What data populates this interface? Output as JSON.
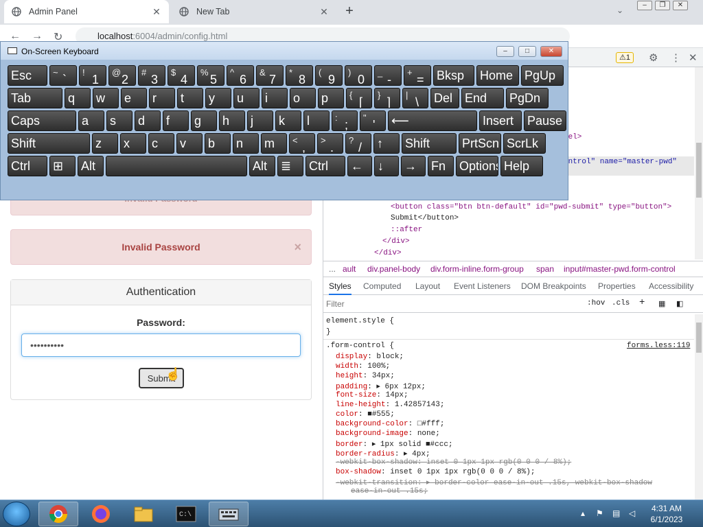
{
  "browser": {
    "tabs": [
      {
        "title": "Admin Panel",
        "active": true
      },
      {
        "title": "New Tab",
        "active": false
      }
    ],
    "new_tab_label": "+",
    "url_host": "localhost",
    "url_rest": ":6004/admin/config.html"
  },
  "page": {
    "alert_partial": "Invalid Password",
    "alert_text": "Invalid Password",
    "alert_close": "×",
    "panel_title": "Authentication",
    "password_label": "Password:",
    "password_value": "••••••••••",
    "submit_label": "Submit"
  },
  "osk": {
    "title": "On-Screen Keyboard",
    "rows": [
      [
        [
          "Esc",
          ""
        ],
        [
          "`",
          "~"
        ],
        [
          "1",
          "!"
        ],
        [
          "2",
          "@"
        ],
        [
          "3",
          "#"
        ],
        [
          "4",
          "$"
        ],
        [
          "5",
          "%"
        ],
        [
          "6",
          "^"
        ],
        [
          "7",
          "&"
        ],
        [
          "8",
          "*"
        ],
        [
          "9",
          "("
        ],
        [
          "0",
          ")"
        ],
        [
          "-",
          "_"
        ],
        [
          "=",
          "+"
        ],
        [
          "Bksp",
          ""
        ],
        [
          "Home",
          ""
        ],
        [
          "PgUp",
          ""
        ]
      ],
      [
        [
          "Tab",
          ""
        ],
        [
          "q",
          ""
        ],
        [
          "w",
          ""
        ],
        [
          "e",
          ""
        ],
        [
          "r",
          ""
        ],
        [
          "t",
          ""
        ],
        [
          "y",
          ""
        ],
        [
          "u",
          ""
        ],
        [
          "i",
          ""
        ],
        [
          "o",
          ""
        ],
        [
          "p",
          ""
        ],
        [
          "[",
          "{"
        ],
        [
          "]",
          "}"
        ],
        [
          "\\",
          "|"
        ],
        [
          "Del",
          ""
        ],
        [
          "End",
          ""
        ],
        [
          "PgDn",
          ""
        ]
      ],
      [
        [
          "Caps",
          ""
        ],
        [
          "a",
          ""
        ],
        [
          "s",
          ""
        ],
        [
          "d",
          ""
        ],
        [
          "f",
          ""
        ],
        [
          "g",
          ""
        ],
        [
          "h",
          ""
        ],
        [
          "j",
          ""
        ],
        [
          "k",
          ""
        ],
        [
          "l",
          ""
        ],
        [
          ";",
          ":"
        ],
        [
          "'",
          "\""
        ],
        [
          "⟵",
          ""
        ],
        [
          "Insert",
          ""
        ],
        [
          "Pause",
          ""
        ]
      ],
      [
        [
          "Shift",
          ""
        ],
        [
          "z",
          ""
        ],
        [
          "x",
          ""
        ],
        [
          "c",
          ""
        ],
        [
          "v",
          ""
        ],
        [
          "b",
          ""
        ],
        [
          "n",
          ""
        ],
        [
          "m",
          ""
        ],
        [
          ",",
          "<"
        ],
        [
          ".",
          ">"
        ],
        [
          "/",
          "?"
        ],
        [
          "↑",
          ""
        ],
        [
          "Shift",
          ""
        ],
        [
          "PrtScn",
          ""
        ],
        [
          "ScrLk",
          ""
        ]
      ],
      [
        [
          "Ctrl",
          ""
        ],
        [
          "⊞",
          ""
        ],
        [
          "Alt",
          ""
        ],
        [
          "",
          ""
        ],
        [
          "Alt",
          ""
        ],
        [
          "≣",
          ""
        ],
        [
          "Ctrl",
          ""
        ],
        [
          "←",
          ""
        ],
        [
          "↓",
          ""
        ],
        [
          "→",
          ""
        ],
        [
          "Fn",
          ""
        ],
        [
          "Options",
          ""
        ],
        [
          "Help",
          ""
        ]
      ]
    ]
  },
  "devtools": {
    "warning_count": "1",
    "code_lines": [
      {
        "t": "bel>"
      },
      {
        "t": "ontrol\" name=\"master-pwd\""
      },
      {
        "t": "<button class=\"btn btn-default\" id=\"pwd-submit\" type=\"button\">"
      },
      {
        "t": "Submit</button>"
      },
      {
        "t": "::after"
      },
      {
        "t": "</div>"
      },
      {
        "t": "</div>"
      }
    ],
    "breadcrumbs": [
      "...",
      "ault",
      "div.panel-body",
      "div.form-inline.form-group",
      "span",
      "input#master-pwd.form-control"
    ],
    "subtabs": [
      "Styles",
      "Computed",
      "Layout",
      "Event Listeners",
      "DOM Breakpoints",
      "Properties",
      "Accessibility"
    ],
    "filter_placeholder": "Filter",
    "filter_hov": ":hov",
    "filter_cls": ".cls",
    "filter_plus": "+",
    "element_style": "element.style {",
    "element_close": "}",
    "rule_selector": ".form-control {",
    "rule_source": "forms.less:119",
    "props": [
      {
        "p": "display",
        "v": "block;"
      },
      {
        "p": "width",
        "v": "100%;"
      },
      {
        "p": "height",
        "v": "34px;"
      },
      {
        "p": "padding",
        "v": "▸ 6px 12px;"
      },
      {
        "p": "font-size",
        "v": "14px;"
      },
      {
        "p": "line-height",
        "v": "1.42857143;"
      },
      {
        "p": "color",
        "v": "■#555;"
      },
      {
        "p": "background-color",
        "v": "□#fff;"
      },
      {
        "p": "background-image",
        "v": "none;"
      },
      {
        "p": "border",
        "v": "▸ 1px solid ■#ccc;"
      },
      {
        "p": "border-radius",
        "v": "▸ 4px;"
      },
      {
        "p": "-webkit-box-shadow",
        "v": "inset 0 1px 1px rgb(0 0 0 / 8%);",
        "strike": true
      },
      {
        "p": "box-shadow",
        "v": "inset 0 1px 1px rgb(0 0 0 / 8%);"
      },
      {
        "p": "-webkit-transition",
        "v": "▸ border-color ease-in-out .15s, webkit-box-shadow",
        "strike": true
      },
      {
        "p": "",
        "v": "ease-in-out .15s;",
        "strike": true
      }
    ]
  },
  "taskbar": {
    "time": "4:31 AM",
    "date": "6/1/2023"
  }
}
